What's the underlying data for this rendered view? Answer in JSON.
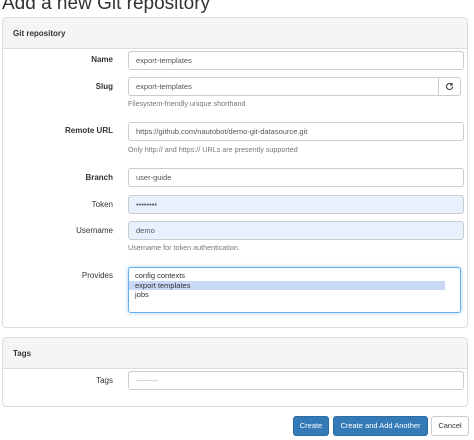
{
  "page": {
    "title": "Add a new Git repository"
  },
  "git_panel": {
    "heading": "Git repository",
    "name": {
      "label": "Name",
      "value": "export-templates"
    },
    "slug": {
      "label": "Slug",
      "value": "export-templates",
      "help": "Filesystem-friendly unique shorthand",
      "regen_icon": "refresh-icon"
    },
    "remote_url": {
      "label": "Remote URL",
      "value": "https://github.com/nautobot/demo-git-datasource.git",
      "help": "Only http:// and https:// URLs are presently supported"
    },
    "branch": {
      "label": "Branch",
      "value": "user-guide"
    },
    "token": {
      "label": "Token",
      "value": "••••••••"
    },
    "username": {
      "label": "Username",
      "value": "demo",
      "help": "Username for token authentication."
    },
    "provides": {
      "label": "Provides",
      "options": [
        "config contexts",
        "export templates",
        "jobs"
      ],
      "selected": "export templates"
    }
  },
  "tags_panel": {
    "heading": "Tags",
    "tags": {
      "label": "Tags",
      "placeholder": "---------"
    }
  },
  "actions": {
    "create": "Create",
    "create_add_another": "Create and Add Another",
    "cancel": "Cancel"
  },
  "colors": {
    "primary": "#337ab7",
    "autofill": "#e8f0fe",
    "selection": "#c9d8f5"
  }
}
